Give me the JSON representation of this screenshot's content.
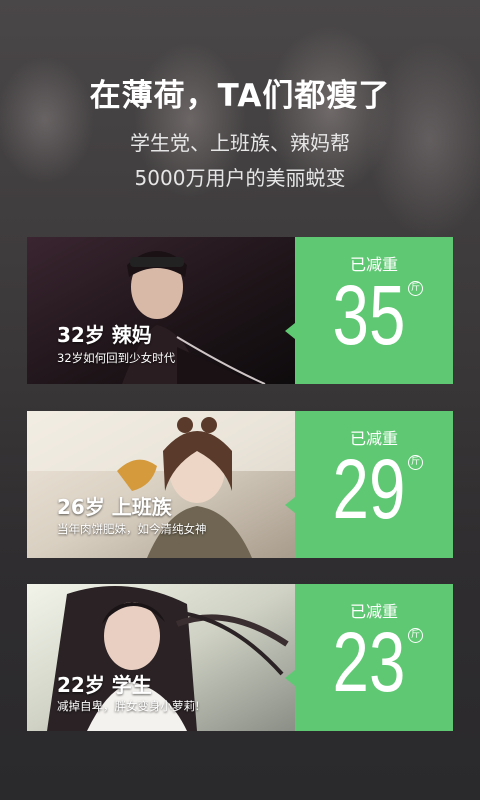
{
  "hero": {
    "title": "在薄荷，TA们都瘦了",
    "subtitle_line1": "学生党、上班族、辣妈帮",
    "subtitle_line2": "5000万用户的美丽蜕变"
  },
  "cards": [
    {
      "label": "32岁  辣妈",
      "tagline": "32岁如何回到少女时代",
      "stat_caption": "已减重",
      "stat_value": "35",
      "stat_unit": "斤"
    },
    {
      "label": "26岁  上班族",
      "tagline": "当年肉饼肥妹，如今清纯女神",
      "stat_caption": "已减重",
      "stat_value": "29",
      "stat_unit": "斤"
    },
    {
      "label": "22岁  学生",
      "tagline": "减掉自卑，胖女变身小萝莉!",
      "stat_caption": "已减重",
      "stat_value": "23",
      "stat_unit": "斤"
    }
  ],
  "colors": {
    "accent": "#5fc873",
    "background": "#2b2b2d"
  }
}
